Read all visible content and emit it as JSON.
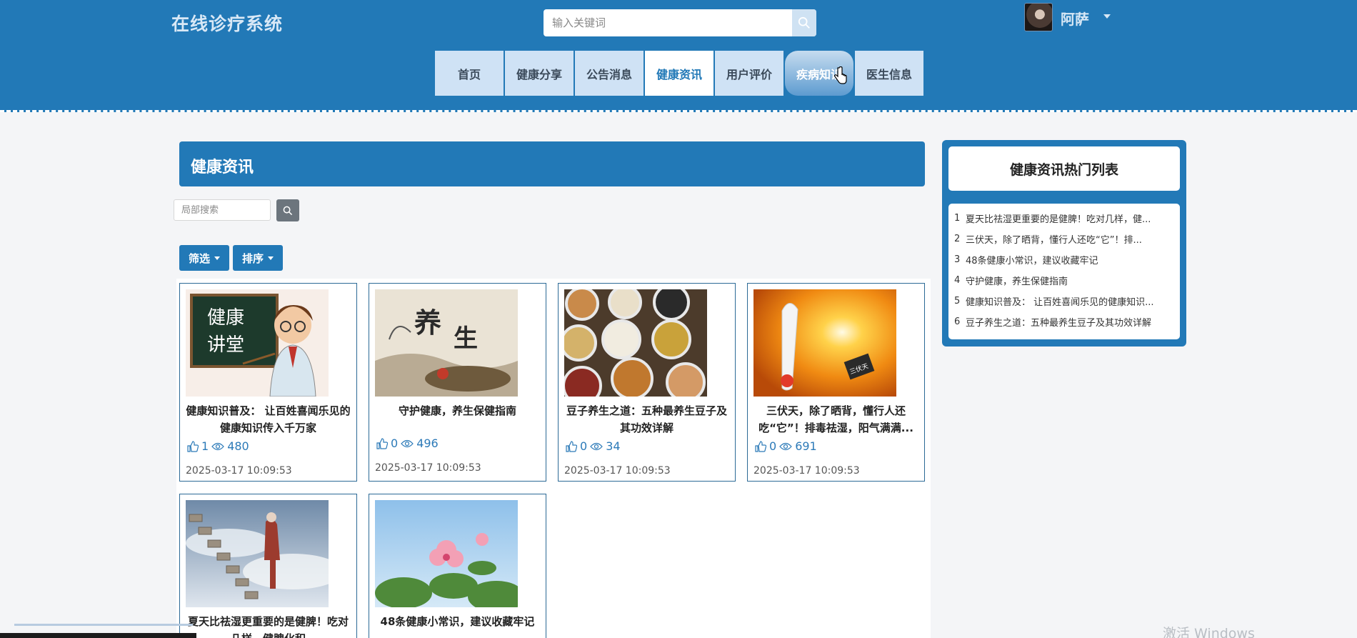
{
  "header": {
    "site_title": "在线诊疗系统",
    "search_placeholder": "输入关键词",
    "user_name": "阿萨"
  },
  "nav": [
    {
      "label": "首页",
      "state": "normal"
    },
    {
      "label": "健康分享",
      "state": "normal"
    },
    {
      "label": "公告消息",
      "state": "normal"
    },
    {
      "label": "健康资讯",
      "state": "active"
    },
    {
      "label": "用户评价",
      "state": "normal"
    },
    {
      "label": "疾病知识",
      "state": "hover"
    },
    {
      "label": "医生信息",
      "state": "normal"
    }
  ],
  "main": {
    "title": "健康资讯",
    "local_search_placeholder": "局部搜索",
    "filter_label": "筛选",
    "sort_label": "排序"
  },
  "cards": [
    {
      "title": "健康知识普及： 让百姓喜闻乐见的健康知识传入千万家",
      "likes": "1",
      "views": "480",
      "date": "2025-03-17 10:09:53",
      "image": "blackboard",
      "image_text": "健康\n讲堂"
    },
    {
      "title": "守护健康，养生保健指南",
      "likes": "0",
      "views": "496",
      "date": "2025-03-17 10:09:53",
      "image": "ink-painting",
      "image_text": "养生"
    },
    {
      "title": "豆子养生之道：五种最养生豆子及其功效详解",
      "likes": "0",
      "views": "34",
      "date": "2025-03-17 10:09:53",
      "image": "beans"
    },
    {
      "title": "三伏天，除了晒背，懂行人还吃“它”！排毒祛湿，阳气满满...",
      "likes": "0",
      "views": "691",
      "date": "2025-03-17 10:09:53",
      "image": "thermometer",
      "image_text": "三伏天"
    },
    {
      "title": "夏天比祛湿更重要的是健脾！吃对几样，健脾化积",
      "likes": "",
      "views": "",
      "date": "",
      "image": "stairs"
    },
    {
      "title": "48条健康小常识，建议收藏牢记",
      "likes": "",
      "views": "",
      "date": "",
      "image": "flower"
    }
  ],
  "sidebar": {
    "title": "健康资讯热门列表",
    "items": [
      {
        "num": "1",
        "text": "夏天比祛湿更重要的是健脾！吃对几样，健..."
      },
      {
        "num": "2",
        "text": "三伏天，除了晒背，懂行人还吃“它”！排..."
      },
      {
        "num": "3",
        "text": "48条健康小常识，建议收藏牢记"
      },
      {
        "num": "4",
        "text": "守护健康，养生保健指南"
      },
      {
        "num": "5",
        "text": "健康知识普及： 让百姓喜闻乐见的健康知识..."
      },
      {
        "num": "6",
        "text": "豆子养生之道：五种最养生豆子及其功效详解"
      }
    ]
  },
  "watermark": "激活 Windows",
  "colors": {
    "primary": "#2279b7",
    "nav_bg": "#cfe2f5",
    "card_border": "#2c6a96",
    "stat_blue": "#2c7ab8"
  },
  "icons": [
    "search-icon",
    "thumbs-up-icon",
    "eye-icon",
    "chevron-down-icon",
    "hand-cursor-icon"
  ]
}
